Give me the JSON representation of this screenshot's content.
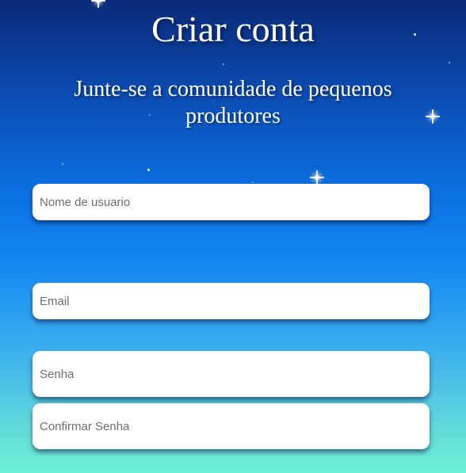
{
  "header": {
    "title": "Criar conta",
    "subtitle": "Junte-se a comunidade de pequenos produtores"
  },
  "form": {
    "username_placeholder": "Nome de usuario",
    "email_placeholder": "Email",
    "password_placeholder": "Senha",
    "confirm_password_placeholder": "Confirmar Senha"
  },
  "colors": {
    "gradient_top": "#0a2a78",
    "gradient_bottom": "#6ff0d6",
    "field_background": "#ffffff",
    "text_primary": "#ffffff"
  }
}
